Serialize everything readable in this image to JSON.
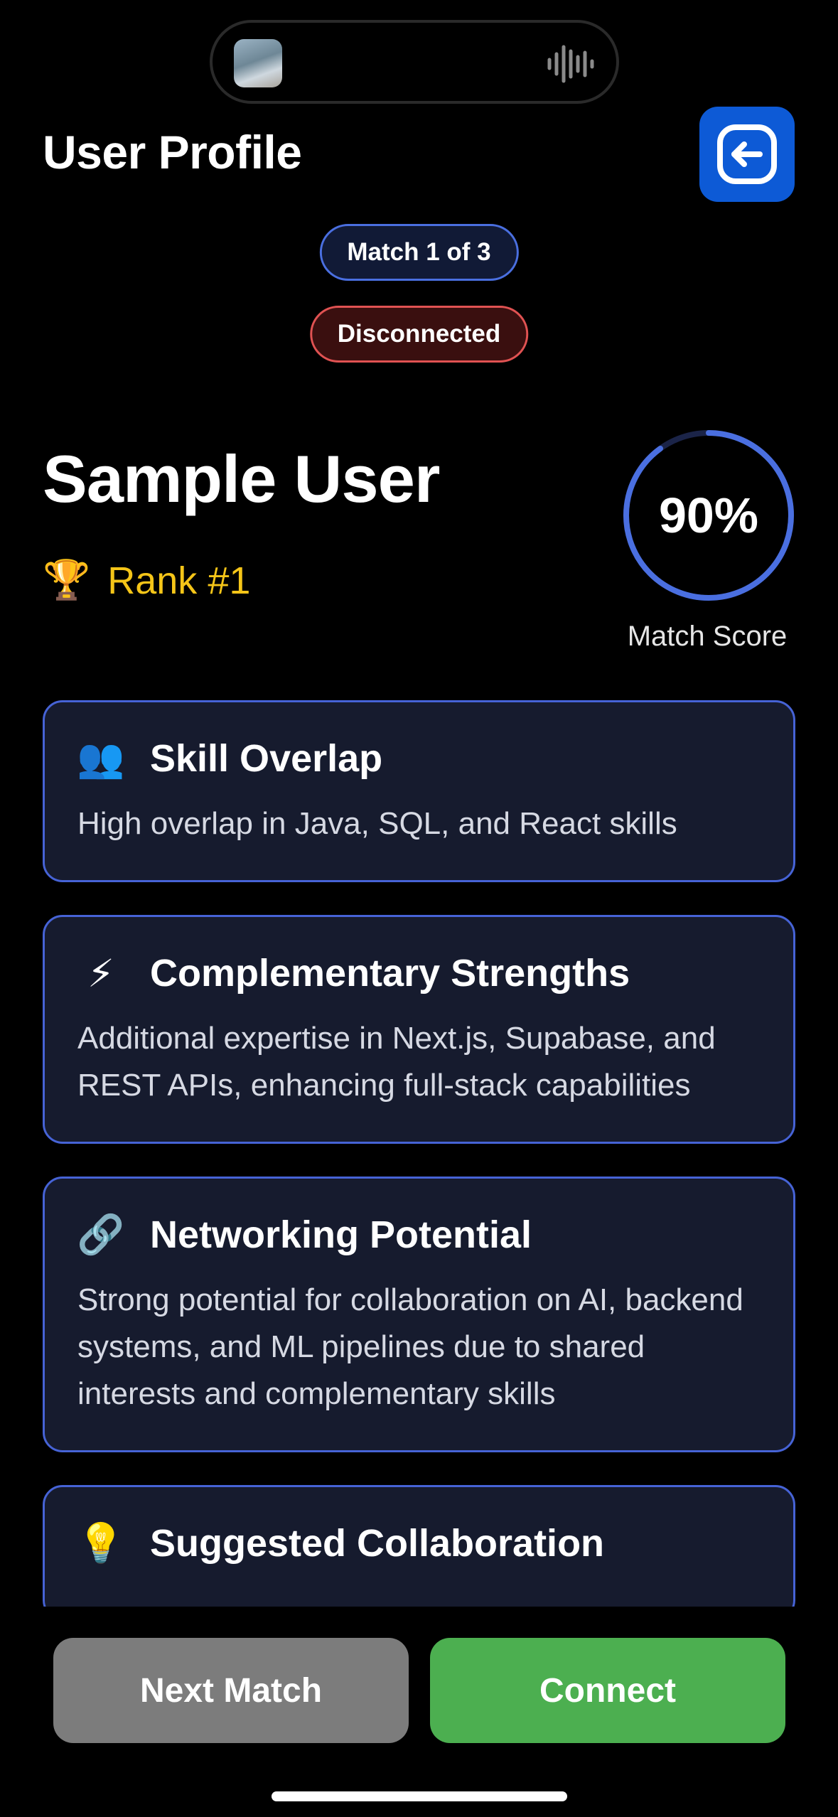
{
  "header": {
    "title": "User Profile",
    "back_icon": "logout-arrow-icon"
  },
  "match_counter": "Match 1 of 3",
  "status": {
    "label": "Disconnected",
    "color": "#e05252"
  },
  "profile": {
    "name": "Sample User",
    "rank_icon": "trophy-icon",
    "rank": "Rank #1",
    "match_score": 0.9,
    "match_score_text": "90%",
    "match_score_label": "Match Score"
  },
  "cards": [
    {
      "icon": "people-icon",
      "title": "Skill Overlap",
      "description": "High overlap in Java, SQL, and React skills"
    },
    {
      "icon": "lightning-icon",
      "title": "Complementary Strengths",
      "description": "Additional expertise in Next.js, Supabase, and REST APIs, enhancing full-stack capabilities"
    },
    {
      "icon": "link-icon",
      "title": "Networking Potential",
      "description": "Strong potential for collaboration on AI, backend systems, and ML pipelines due to shared interests and complementary skills"
    },
    {
      "icon": "lightbulb-icon",
      "title": "Suggested Collaboration",
      "description": ""
    }
  ],
  "actions": {
    "next_label": "Next Match",
    "connect_label": "Connect"
  },
  "colors": {
    "accent": "#4663d6",
    "connect": "#4caf50",
    "next": "#7c7c7c",
    "rank": "#f5c518"
  }
}
